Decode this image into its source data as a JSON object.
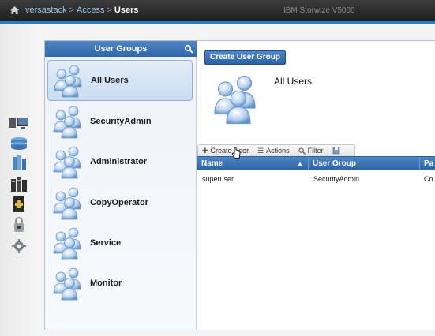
{
  "header": {
    "home_icon": "home-icon",
    "breadcrumb": [
      "versastack",
      "Access",
      "Users"
    ],
    "separator": ">",
    "product": "IBM Storwize V5000"
  },
  "rail": {
    "icons": [
      "system-monitor-icon",
      "pools-icon",
      "volumes-icon",
      "hosts-icon",
      "copy-services-icon",
      "access-lock-icon",
      "settings-gear-icon"
    ]
  },
  "groups_panel": {
    "title": "User Groups",
    "search_icon": "search-icon",
    "items": [
      {
        "label": "All Users",
        "selected": true
      },
      {
        "label": "SecurityAdmin"
      },
      {
        "label": "Administrator"
      },
      {
        "label": "CopyOperator"
      },
      {
        "label": "Service"
      },
      {
        "label": "Monitor"
      }
    ]
  },
  "main": {
    "create_group_button": "Create User Group",
    "selected_group_title": "All Users",
    "toolbar": {
      "create_user": "Create User",
      "actions": "Actions",
      "filter": "Filter"
    },
    "table": {
      "columns": [
        "Name",
        "User Group",
        "Pa"
      ],
      "rows": [
        [
          "superuser",
          "SecurityAdmin",
          "Co"
        ]
      ]
    }
  },
  "colors": {
    "accent_blue": "#2f79c2",
    "header_blue": "#3a72b5",
    "topbar": "#2a2a2a"
  }
}
